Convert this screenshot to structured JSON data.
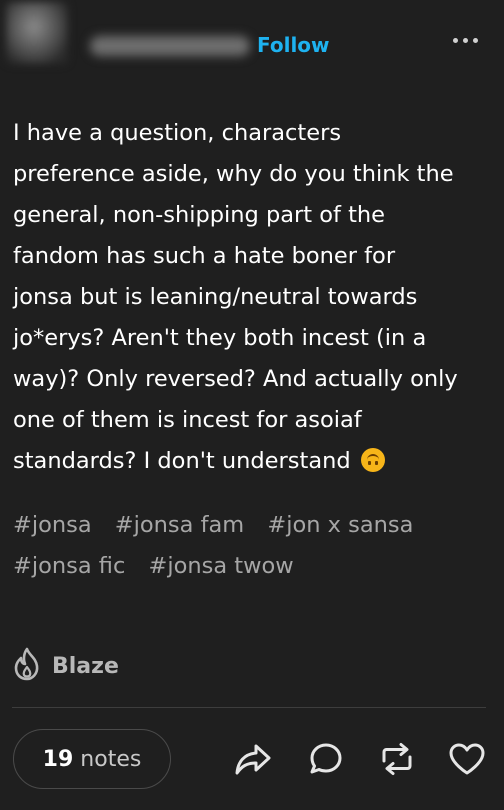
{
  "post": {
    "follow_label": "Follow",
    "body_lines": [
      "I have a question, characters",
      "preference aside, why do you think the",
      "general, non-shipping part of the",
      "fandom has such a hate boner for",
      "jonsa but is leaning/neutral towards",
      "jo*erys? Aren't they both incest (in a",
      "way)? Only reversed? And actually only",
      "one of them is incest for asoiaf",
      "standards? I don't understand"
    ],
    "tags": [
      "#jonsa",
      "#jonsa fam",
      "#jon x sansa",
      "#jonsa fic",
      "#jonsa twow"
    ]
  },
  "footer": {
    "blaze_label": "Blaze",
    "notes_count": "19",
    "notes_label": "notes"
  },
  "icons": {
    "more": "more-horizontal-icon",
    "blaze": "flame-icon",
    "share": "share-arrow-icon",
    "reply": "speech-bubble-icon",
    "reblog": "reblog-icon",
    "like": "heart-icon",
    "emoji": "upside-down-face-emoji"
  },
  "colors": {
    "background": "#1f1f1f",
    "follow": "#1eb2f0",
    "text": "#ffffff",
    "tags": "#a6a6a6"
  }
}
